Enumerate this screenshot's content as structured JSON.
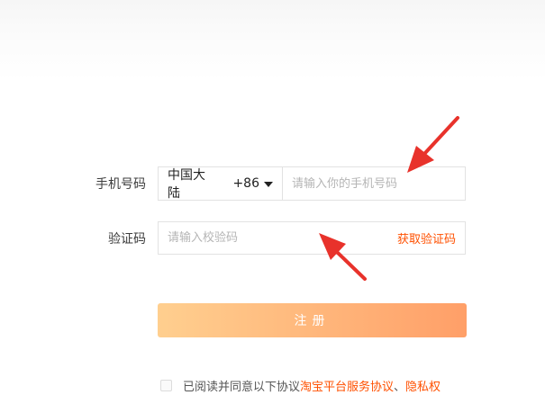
{
  "form": {
    "phone_label": "手机号码",
    "region_name": "中国大陆",
    "region_code": "+86",
    "phone_placeholder": "请输入你的手机号码",
    "code_label": "验证码",
    "code_placeholder": "请输入校验码",
    "get_code_label": "获取验证码",
    "submit_label": "注册"
  },
  "agreement": {
    "prefix": "已阅读并同意以下协议",
    "link_service": "淘宝平台服务协议",
    "separator": "、",
    "link_privacy": "隐私权"
  },
  "annotations": {
    "arrow_color": "#e8322b"
  },
  "colors": {
    "accent": "#ff5000",
    "button_gradient_start": "#ffcf8f",
    "button_gradient_end": "#ff9f68"
  }
}
